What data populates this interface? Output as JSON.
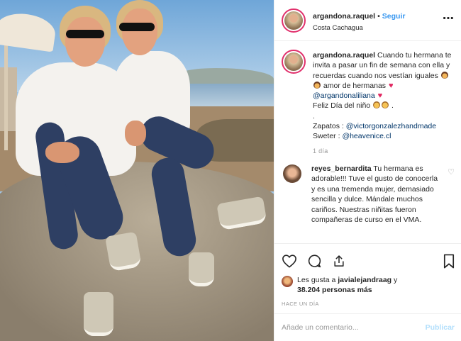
{
  "post": {
    "username": "argandona.raquel",
    "follow_label": "Seguir",
    "location": "Costa Cachagua",
    "more_icon": "more-options-icon"
  },
  "caption": {
    "username": "argandona.raquel",
    "text_1": "Cuando tu hermana te invita a pasar un fin de semana con ella y recuerdas cuando nos vestían iguales",
    "text_2": "amor de hermanas",
    "mention_1": "@argandonaliliana",
    "text_3": "Feliz Día del niño",
    "text_4": ".",
    "text_5": ".",
    "shoes_label": "Zapatos :",
    "shoes_mention": "@victorgonzalezhandmade",
    "sweater_label": "Sweter :",
    "sweater_mention": "@heavenice.cl",
    "time": "1 día"
  },
  "comment": {
    "username": "reyes_bernardita",
    "text": "Tu hermana es adorable!!! Tuve el gusto de conocerla y es una tremenda mujer, demasiado sencilla y dulce. Mándale muchos cariños. Nuestras niñitas fueron compañeras de curso en el VMA."
  },
  "actions": {
    "likes_prefix": "Les gusta a",
    "likes_user": "javialejandraag",
    "likes_and": "y",
    "likes_count": "38.204 personas más",
    "ago": "HACE UN DÍA"
  },
  "add_comment": {
    "placeholder": "Añade un comentario...",
    "post_label": "Publicar"
  },
  "colors": {
    "accent": "#3897f0",
    "text": "#262626",
    "muted": "#999999",
    "post_disabled": "#b2dffc"
  }
}
